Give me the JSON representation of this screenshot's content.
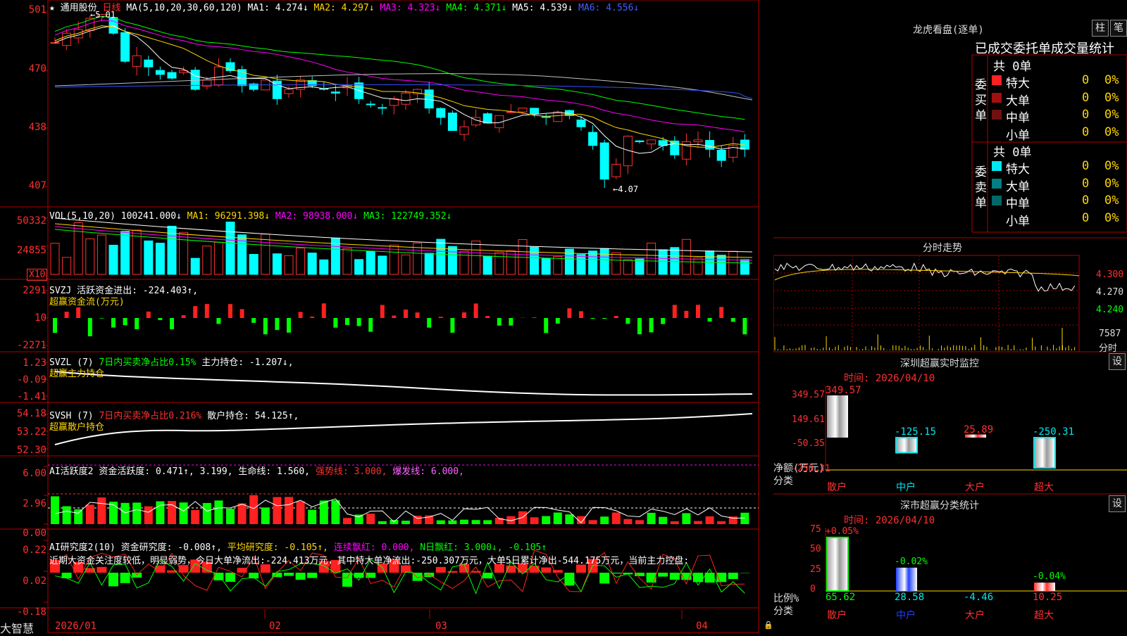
{
  "header": {
    "star": "★",
    "stock_name": "通用股份",
    "period": "日线",
    "ma_params": "MA(5,10,20,30,60,120)",
    "ma1": "MA1: 4.274↓",
    "ma2": "MA2: 4.297↓",
    "ma3": "MA3: 4.323↓",
    "ma4": "MA4: 4.371↓",
    "ma5": "MA5: 4.539↓",
    "ma6": "MA6: 4.556↓"
  },
  "price_axis": [
    "501",
    "470",
    "438",
    "407"
  ],
  "price_high_label": "5.01",
  "price_low_label": "4.07",
  "vol": {
    "params": "VOL(5,10,20)",
    "value": "100241.000↓",
    "ma1": "MA1: 96291.398↓",
    "ma2": "MA2: 98938.000↓",
    "ma3": "MA3: 122749.352↓",
    "axis": [
      "50332",
      "24855"
    ],
    "unit": "X10"
  },
  "svzj": {
    "title": "SVZJ",
    "label": "活跃资金进出: -224.403↑,",
    "sub": "超赢资金流(万元)",
    "axis": [
      "2291",
      "10",
      "-2271"
    ]
  },
  "svzl": {
    "title": "SVZL (7)",
    "label1": "7日内买卖净占比0.15%",
    "label2": "主力持仓: -1.207↓,",
    "sub": "超赢主力持仓",
    "axis": [
      "1.23",
      "-0.09",
      "-1.41"
    ]
  },
  "svsh": {
    "title": "SVSH (7)",
    "label1": "7日内买卖净占比0.216%",
    "label2": "散户持仓: 54.125↑,",
    "sub": "超赢散户持仓",
    "axis": [
      "54.18",
      "53.22",
      "52.30"
    ]
  },
  "ai1": {
    "title": "AI活跃度2",
    "label1": "资金活跃度: 0.471↑, 3.199,",
    "label2": "生命线: 1.560,",
    "label3": "强势线: 3.000,",
    "label4": "爆发线: 6.000,",
    "axis": [
      "6.00",
      "2.96",
      "0.00"
    ]
  },
  "ai2": {
    "title": "AI研究度2(10)",
    "label1": "资金研究度: -0.008↑,",
    "label2": "平均研究度: -0.105↑,",
    "label3": "连续飘红: 0.000,",
    "label4": "N日飘红: 3.000↓, -0.105↑",
    "comment": "近期大资金关注度较低，明显弱势，今日大单净流出:-224.413万元，其中特大单净流出:-250.307万元，大单5日累计净出-544.175万元，当前主力控盘:",
    "axis": [
      "0.22",
      "0.02",
      "-0.18"
    ]
  },
  "dates": [
    "2026/01",
    "02",
    "03",
    "04"
  ],
  "logo": "大智慧",
  "right": {
    "longhu_title": "龙虎看盘(逐单)",
    "btn_zhu": "柱",
    "btn_bi": "笔",
    "stat_title": "已成交委托单成交量统计",
    "buy_total": "共 0单",
    "buy_label": "委买单",
    "sell_total": "共 0单",
    "sell_label": "委卖单",
    "buy_rows": [
      {
        "name": "特大",
        "count": "0",
        "pct": "0%",
        "color": "#ff2020"
      },
      {
        "name": "大单",
        "count": "0",
        "pct": "0%",
        "color": "#a01010"
      },
      {
        "name": "中单",
        "count": "0",
        "pct": "0%",
        "color": "#701010"
      },
      {
        "name": "小单",
        "count": "0",
        "pct": "0%",
        "color": "#000000"
      }
    ],
    "sell_rows": [
      {
        "name": "特大",
        "count": "0",
        "pct": "0%",
        "color": "#00e8f0"
      },
      {
        "name": "大单",
        "count": "0",
        "pct": "0%",
        "color": "#008080"
      },
      {
        "name": "中单",
        "count": "0",
        "pct": "0%",
        "color": "#006868"
      },
      {
        "name": "小单",
        "count": "0",
        "pct": "0%",
        "color": "#000000"
      }
    ],
    "fenshi_title": "分时走势",
    "fenshi_axis": [
      "4.300",
      "4.270",
      "4.240"
    ],
    "fenshi_vol": "7587",
    "fenshi_unit": "分时",
    "sz_title": "深圳超赢实时监控",
    "sz_btn": "设",
    "sz_time": "时间: 2026/04/10",
    "sz_axis": [
      "349.57",
      "149.61",
      "-50.35",
      "-250.31"
    ],
    "sz_ylabel": "净额(万元)",
    "sz_xlabel": "分类",
    "sz_cats": [
      "散户",
      "中户",
      "大户",
      "超大"
    ],
    "sz_values": [
      "349.57",
      "-125.15",
      "25.89",
      "-250.31"
    ],
    "ss_title": "深市超赢分类统计",
    "ss_btn": "设",
    "ss_time": "时间: 2026/04/10",
    "ss_axis": [
      "75",
      "50",
      "25",
      "0"
    ],
    "ss_ylabel": "比例%",
    "ss_xlabel": "分类",
    "ss_cats": [
      "散户",
      "中户",
      "大户",
      "超大"
    ],
    "ss_top": [
      "+0.05%",
      "-0.02%",
      "",
      "-0.04%"
    ],
    "ss_values": [
      "65.62",
      "28.58",
      "-4.46",
      "10.25"
    ]
  },
  "chart_data": {
    "type": "candlestick",
    "symbol": "通用股份",
    "high": 5.01,
    "low": 4.07,
    "sz_monitor": {
      "categories": [
        "散户",
        "中户",
        "大户",
        "超大"
      ],
      "values": [
        349.57,
        -125.15,
        25.89,
        -250.31
      ]
    },
    "ss_stats": {
      "categories": [
        "散户",
        "中户",
        "大户",
        "超大"
      ],
      "values": [
        65.62,
        28.58,
        -4.46,
        10.25
      ]
    }
  }
}
